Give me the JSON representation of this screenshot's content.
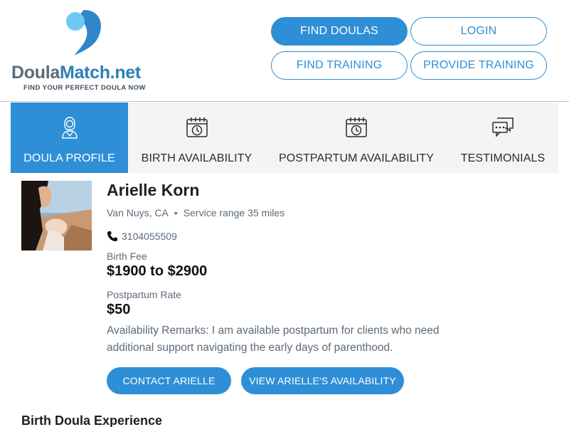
{
  "brand": {
    "name_part1": "Doula",
    "name_part2": "Match.net",
    "tagline": "FIND YOUR PERFECT DOULA NOW",
    "colors": {
      "primary": "#2e8fd6",
      "logo_light": "#6ec8f5",
      "logo_dark": "#2f86c8",
      "text_gray": "#5b6a78"
    }
  },
  "nav": {
    "find_doulas": "FIND DOULAS",
    "login": "LOGIN",
    "find_training": "FIND TRAINING",
    "provide_training": "PROVIDE TRAINING"
  },
  "tabs": [
    {
      "label": "DOULA PROFILE",
      "icon": "doula-person-icon",
      "active": true
    },
    {
      "label": "BIRTH AVAILABILITY",
      "icon": "calendar-clock-icon",
      "active": false
    },
    {
      "label": "POSTPARTUM AVAILABILITY",
      "icon": "calendar-clock-icon",
      "active": false
    },
    {
      "label": "TESTIMONIALS",
      "icon": "chat-bubbles-icon",
      "active": false
    }
  ],
  "profile": {
    "name": "Arielle Korn",
    "city": "Van Nuys, CA",
    "service_range": "Service range 35 miles",
    "phone": "3104055509",
    "birth_fee_label": "Birth Fee",
    "birth_fee": "$1900 to $2900",
    "postpartum_label": "Postpartum Rate",
    "postpartum_rate": "$50",
    "remarks": "Availability Remarks: I am available postpartum for clients who need additional support navigating the early days of parenthood."
  },
  "actions": {
    "contact": "CONTACT ARIELLE",
    "availability": "VIEW ARIELLE'S AVAILABILITY"
  },
  "sections": {
    "experience_title": "Birth Doula Experience"
  }
}
